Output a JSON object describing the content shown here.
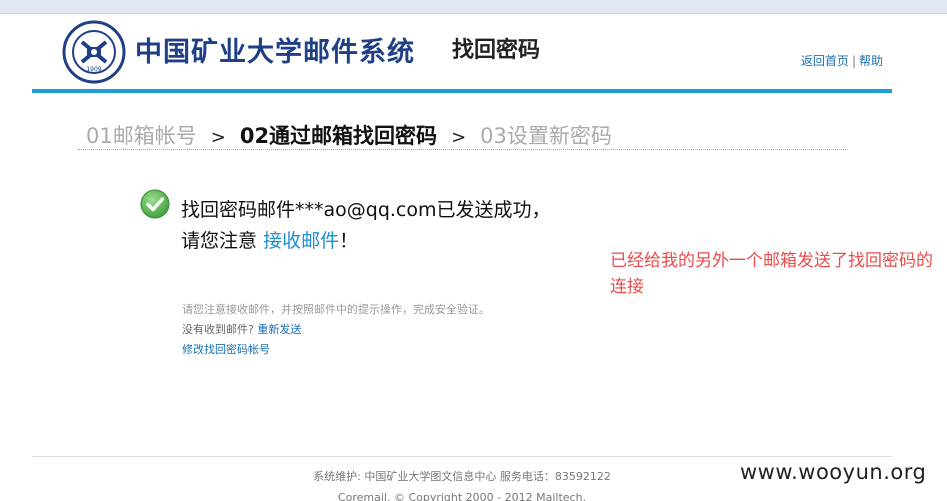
{
  "header": {
    "brand": "中国矿业大学邮件系统",
    "page_heading": "找回密码",
    "links": {
      "home": "返回首页",
      "separator": "|",
      "help": "帮助"
    },
    "logo": {
      "text": "1909",
      "icon": "university-seal-icon"
    }
  },
  "steps": [
    {
      "label": "01邮箱帐号",
      "state": "done"
    },
    {
      "label": "02通过邮箱找回密码",
      "state": "active"
    },
    {
      "label": "03设置新密码",
      "state": "pending"
    }
  ],
  "steps_separator": ">",
  "message": {
    "icon": "success-check-icon",
    "line1": "找回密码邮件***ao@qq.com已发送成功，",
    "line2_prefix": "请您注意",
    "line2_link": "接收邮件",
    "line2_suffix": "！"
  },
  "annotation": "已经给我的另外一个邮箱发送了找回密码的连接",
  "hints": {
    "instruction": "请您注意接收邮件，并按照邮件中的提示操作，完成安全验证。",
    "not_received": "没有收到邮件?",
    "resend": "重新发送",
    "change_account": "修改找回密码帐号"
  },
  "footer": {
    "maintainer": "系统维护: 中国矿业大学图文信息中心 服务电话：83592122",
    "copyright": "Coremail. © Copyright 2000 - 2012 Mailtech."
  },
  "watermark": "www.wooyun.org",
  "colors": {
    "accent": "#1c9fd0",
    "brand": "#1f3f86",
    "link": "#1a6fb0",
    "success": "#5cb85c",
    "annotation": "#e84c4c"
  }
}
